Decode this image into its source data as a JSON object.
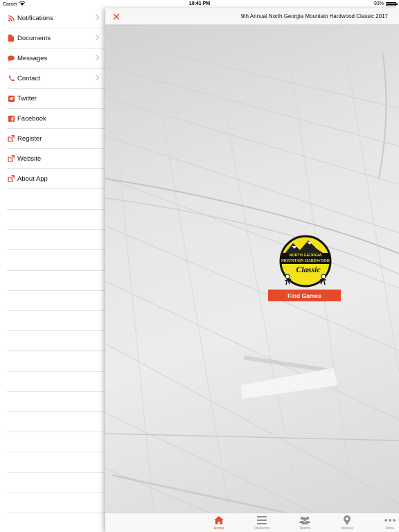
{
  "status_bar": {
    "carrier": "Carrier",
    "time": "10:41 PM",
    "battery": "93%",
    "battery_level": 0.93
  },
  "side_menu": {
    "items": [
      {
        "label": "Notifications",
        "icon": "rss-icon",
        "chevron": true
      },
      {
        "label": "Documents",
        "icon": "document-icon",
        "chevron": true
      },
      {
        "label": "Messages",
        "icon": "chat-icon",
        "chevron": true
      },
      {
        "label": "Contact",
        "icon": "phone-icon",
        "chevron": true
      },
      {
        "label": "Twitter",
        "icon": "twitter-icon",
        "chevron": false
      },
      {
        "label": "Facebook",
        "icon": "facebook-icon",
        "chevron": false
      },
      {
        "label": "Register",
        "icon": "external-link-icon",
        "chevron": false
      },
      {
        "label": "Website",
        "icon": "external-link-icon",
        "chevron": false
      },
      {
        "label": "About App",
        "icon": "external-link-icon",
        "chevron": false
      }
    ]
  },
  "header": {
    "title": "9th Annual North Georgia Mountain Hardwood Classic 2017",
    "close_icon": "close-icon"
  },
  "main": {
    "logo_text_top": "NORTH GEORGIA",
    "logo_text_mid": "MOUNTAIN HARDWOOD",
    "logo_text_script": "Classic",
    "find_games_label": "Find Games"
  },
  "tab_bar": {
    "tabs": [
      {
        "label": "Home",
        "icon": "home-icon",
        "active": true
      },
      {
        "label": "Divisions",
        "icon": "list-icon",
        "active": false
      },
      {
        "label": "Teams",
        "icon": "people-icon",
        "active": false
      },
      {
        "label": "Venues",
        "icon": "map-pin-icon",
        "active": false
      },
      {
        "label": "More",
        "icon": "more-icon",
        "active": false
      }
    ]
  },
  "colors": {
    "accent": "#e54a2b",
    "tab_inactive": "#8e8e8e",
    "logo_yellow": "#f2e21a"
  }
}
